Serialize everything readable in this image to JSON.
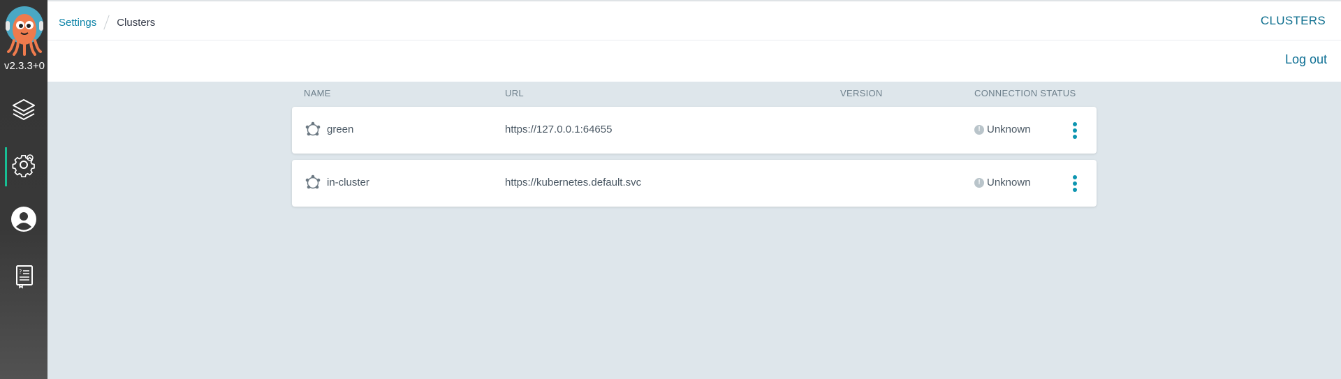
{
  "app": {
    "version": "v2.3.3+0"
  },
  "sidebar": {
    "items": [
      {
        "icon": "layers-icon"
      },
      {
        "icon": "gear-icon",
        "active": true
      },
      {
        "icon": "user-avatar-icon"
      },
      {
        "icon": "docs-icon"
      }
    ]
  },
  "breadcrumb": {
    "parent": "Settings",
    "current": "Clusters"
  },
  "header": {
    "title": "CLUSTERS",
    "logout_label": "Log out"
  },
  "table": {
    "columns": {
      "name": "NAME",
      "url": "URL",
      "version": "VERSION",
      "status": "CONNECTION STATUS"
    },
    "rows": [
      {
        "name": "green",
        "url": "https://127.0.0.1:64655",
        "version": "",
        "status": "Unknown"
      },
      {
        "name": "in-cluster",
        "url": "https://kubernetes.default.svc",
        "version": "",
        "status": "Unknown"
      }
    ]
  },
  "colors": {
    "accent": "#0d95b0",
    "sidebar_bg": "#353535",
    "page_bg": "#dee6eb",
    "active_indicator": "#18be94"
  }
}
